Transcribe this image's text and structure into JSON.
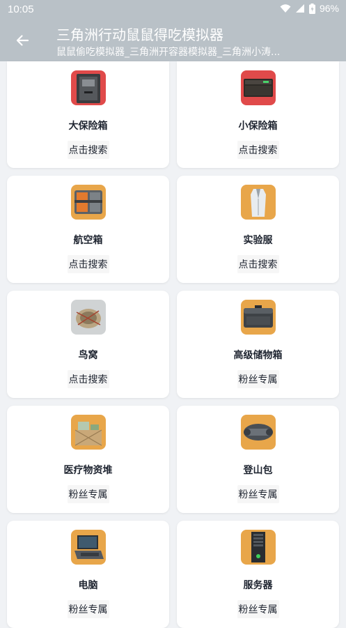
{
  "status_bar": {
    "time": "10:05",
    "battery": "96%"
  },
  "app_bar": {
    "title": "三角洲行动鼠鼠得吃模拟器",
    "subtitle": "鼠鼠偷吃模拟器_三角洲开容器模拟器_三角洲小涛..."
  },
  "items": [
    {
      "name": "大保险箱",
      "action": "点击搜索",
      "icon": "large-safe-icon",
      "bg": "#e04a4a"
    },
    {
      "name": "小保险箱",
      "action": "点击搜索",
      "icon": "small-safe-icon",
      "bg": "#e04a4a"
    },
    {
      "name": "航空箱",
      "action": "点击搜索",
      "icon": "air-case-icon",
      "bg": "#e8a64a"
    },
    {
      "name": "实验服",
      "action": "点击搜索",
      "icon": "lab-coat-icon",
      "bg": "#e8a64a"
    },
    {
      "name": "鸟窝",
      "action": "点击搜索",
      "icon": "bird-nest-icon",
      "bg": "#d0d3d4"
    },
    {
      "name": "高级储物箱",
      "action": "粉丝专属",
      "icon": "storage-box-icon",
      "bg": "#e8a64a"
    },
    {
      "name": "医疗物资堆",
      "action": "粉丝专属",
      "icon": "medical-supplies-icon",
      "bg": "#e8a64a"
    },
    {
      "name": "登山包",
      "action": "粉丝专属",
      "icon": "backpack-icon",
      "bg": "#e8a64a"
    },
    {
      "name": "电脑",
      "action": "粉丝专属",
      "icon": "laptop-icon",
      "bg": "#e8a64a"
    },
    {
      "name": "服务器",
      "action": "粉丝专属",
      "icon": "server-icon",
      "bg": "#e8a64a"
    }
  ]
}
